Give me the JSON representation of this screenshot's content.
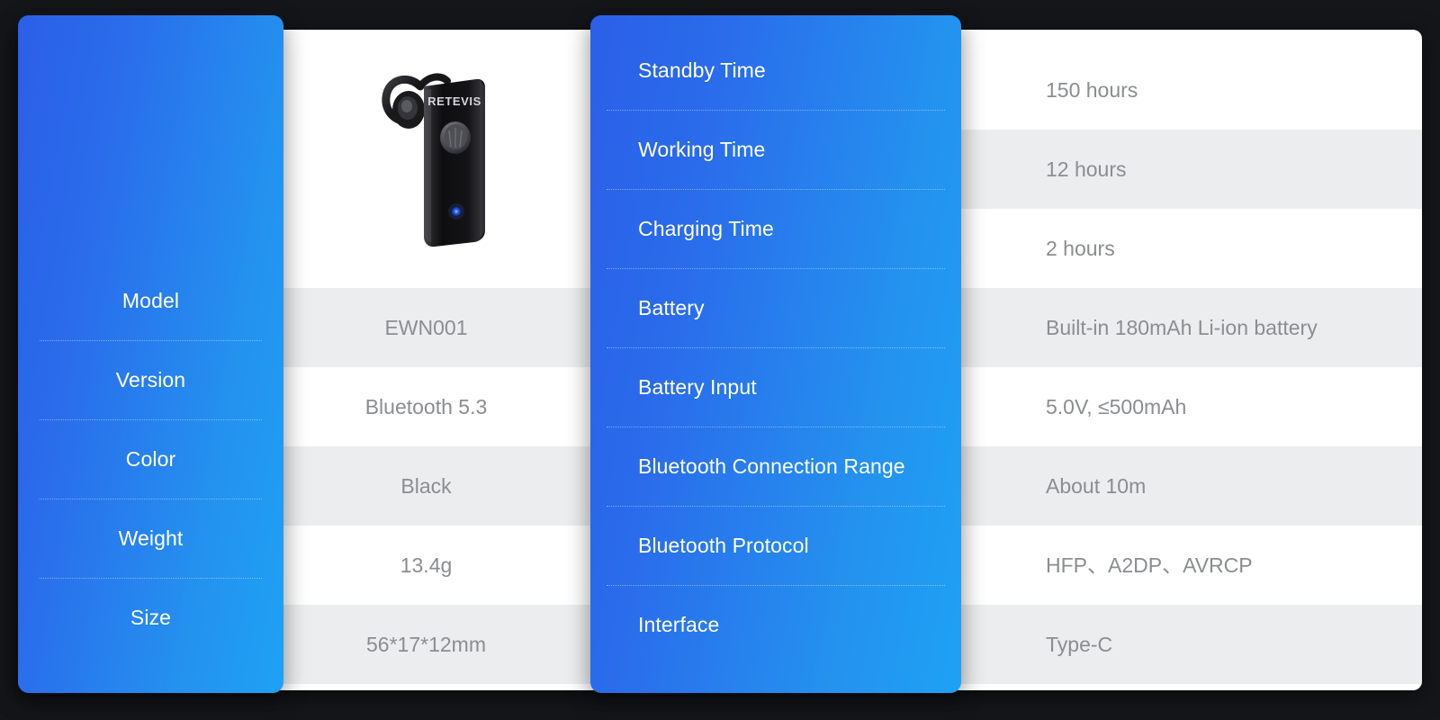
{
  "product": {
    "brand_text": "RETEVIS",
    "image_alt": "bluetooth-headset",
    "colors": {
      "body": "#1b1b1d",
      "accent_led": "#1f4fff"
    }
  },
  "theme": {
    "panel_gradient_start": "#2b5fe8",
    "panel_gradient_end": "#1ea2f4",
    "stripe_color": "#ebedef",
    "card_background": "#ffffff",
    "page_background": "#15161a",
    "label_color": "#ffffff",
    "value_color": "#8b8d90"
  },
  "left_table": {
    "rows": [
      {
        "label": "Model",
        "value": "EWN001"
      },
      {
        "label": "Version",
        "value": "Bluetooth 5.3"
      },
      {
        "label": "Color",
        "value": "Black"
      },
      {
        "label": "Weight",
        "value": "13.4g"
      },
      {
        "label": "Size",
        "value": "56*17*12mm"
      }
    ]
  },
  "right_table": {
    "rows": [
      {
        "label": "Standby Time",
        "value": "150 hours"
      },
      {
        "label": "Working Time",
        "value": "12 hours"
      },
      {
        "label": "Charging Time",
        "value": "2 hours"
      },
      {
        "label": "Battery",
        "value": "Built-in 180mAh Li-ion battery"
      },
      {
        "label": "Battery Input",
        "value": "5.0V, ≤500mAh"
      },
      {
        "label": "Bluetooth Connection Range",
        "value": "About 10m"
      },
      {
        "label": "Bluetooth Protocol",
        "value": "HFP、A2DP、AVRCP"
      },
      {
        "label": "Interface",
        "value": "Type-C"
      }
    ]
  }
}
